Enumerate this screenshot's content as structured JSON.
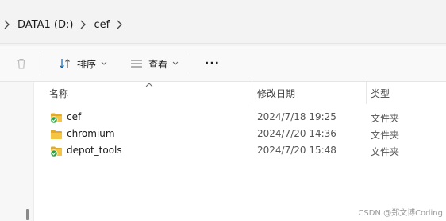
{
  "breadcrumb": {
    "items": [
      "DATA1 (D:)",
      "cef"
    ]
  },
  "toolbar": {
    "sort_label": "排序",
    "view_label": "查看",
    "more_label": "···"
  },
  "columns": {
    "name": "名称",
    "modified": "修改日期",
    "type": "类型"
  },
  "files": [
    {
      "name": "cef",
      "modified": "2024/7/18 19:25",
      "type": "文件夹",
      "status": "synced"
    },
    {
      "name": "chromium",
      "modified": "2024/7/20 14:36",
      "type": "文件夹",
      "status": "none"
    },
    {
      "name": "depot_tools",
      "modified": "2024/7/20 15:48",
      "type": "文件夹",
      "status": "synced"
    }
  ],
  "watermark": "CSDN @郑文博Coding",
  "colors": {
    "folder": "#f4c542",
    "folder_dark": "#e2a92a",
    "sync_green": "#2f9e44",
    "accent": "#0067c0"
  }
}
